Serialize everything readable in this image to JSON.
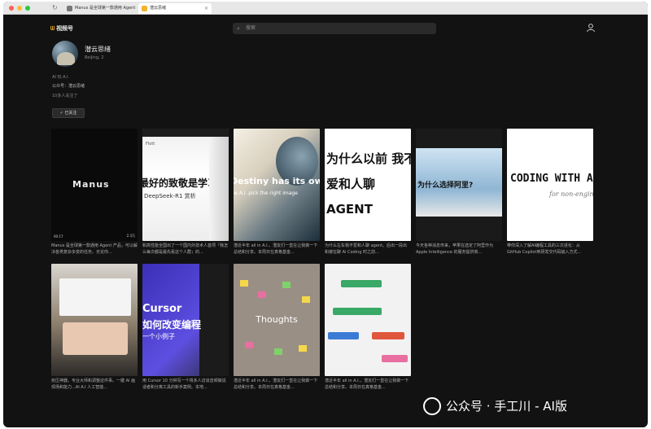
{
  "browser": {
    "tabs": [
      {
        "label": "Manus 是全球第一款通用 Agent"
      },
      {
        "label": "潜云思绪"
      }
    ]
  },
  "header": {
    "logo_label": "视频号",
    "search_placeholder": "搜索"
  },
  "profile": {
    "name": "潜云思绪",
    "location": "Beijing, 2",
    "tagline": "AI 玩 A.I.",
    "official_account": "公众号：潜云思绪",
    "followers": "10多人关注了",
    "follow_button": "已关注"
  },
  "videos": [
    {
      "thumb_text": "Manus",
      "caption": "Manus 是全球第一款通用 Agent 产品，可以解决各类复杂多变的任务。无论你...",
      "overlay_left": "00:17",
      "overlay_right": "2.3万"
    },
    {
      "thumb_text": "最好的致敬是学习",
      "thumb_sub": "DeepSeek-R1 赏析",
      "thumb_top": "Flott",
      "caption": "和高性能全国出了一个国内外技术人首项『我怎么每次都是最先看这个人群』的...",
      "overlay_left": "",
      "overlay_right": ""
    },
    {
      "thumb_text": "Destiny has its own",
      "thumb_sub": "w A.I. pick the right image",
      "caption": "潜近半年 all in A.I.，潜友们一直在让我做一下总结和分享。本周日在真格基金...",
      "overlay_left": "",
      "overlay_right": ""
    },
    {
      "thumb_text": "为什么以前 我不爱和人聊 AGENT",
      "caption": "为什么左车我不爱和人聊 agent。后出一段出和被在聊 Ai Coding 时之前...",
      "overlay_left": "",
      "overlay_right": ""
    },
    {
      "thumb_text": "为什么选择阿里?",
      "caption": "今天各种消息传来，苹果在选定了阿里作为 Apple Intelligence 的服务提供商...",
      "overlay_left": "",
      "overlay_right": ""
    },
    {
      "thumb_text": "CODING WITH A",
      "thumb_sub": "for non-engin",
      "caption": "带你深入了解AI编程工具的三次进化：从 GitHub Copilot到研发交代码输入方式...",
      "overlay_left": "",
      "overlay_right": ""
    },
    {
      "thumb_text": "",
      "caption": "抢压神器，专业大师和调整这件事。一键 AI 画现场和能力...AI  A.I 人工智能...",
      "overlay_left": "",
      "overlay_right": ""
    },
    {
      "thumb_text": "Cursor",
      "thumb_sub": "如何改变编程",
      "thumb_sub2": "一个小例子",
      "caption": "用 Cursor 10 分钟写一个将多人访谈音频做说话者和分离工具的新手案例。本地...",
      "overlay_left": "",
      "overlay_right": ""
    },
    {
      "thumb_text": "Thoughts",
      "caption": "潜近半年 all in A.I.，潜友们一直在让我做一下总结和分享。本周日在真格基金...",
      "overlay_left": "",
      "overlay_right": ""
    },
    {
      "thumb_text": "",
      "caption": "潜近半年 all in A.I.，潜友们一直在让我做一下总结和分享。本周日在真格基金...",
      "overlay_left": "",
      "overlay_right": ""
    }
  ],
  "watermark": {
    "text": "公众号 · 手工川 - AI版"
  },
  "colors": {
    "background": "#121212",
    "accent": "#f3b12c",
    "card_caption": "#b0b0b0"
  }
}
